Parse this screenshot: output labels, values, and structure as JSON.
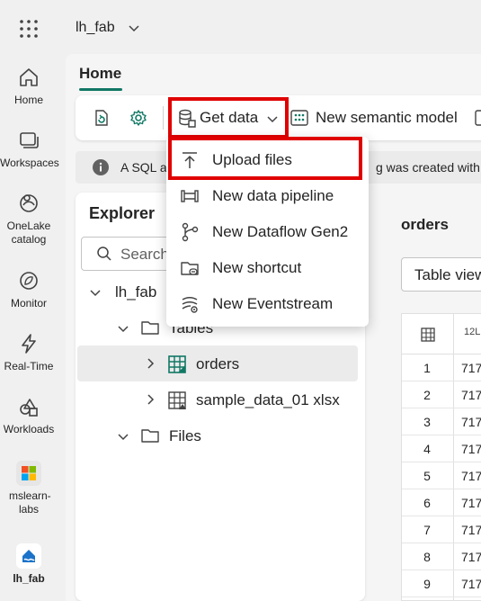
{
  "header": {
    "workspace_title": "lh_fab"
  },
  "rail": {
    "items": [
      {
        "label": "Home",
        "icon": "home-icon"
      },
      {
        "label": "Workspaces",
        "icon": "workspaces-icon"
      },
      {
        "label": "OneLake catalog",
        "icon": "onelake-icon"
      },
      {
        "label": "Monitor",
        "icon": "monitor-icon"
      },
      {
        "label": "Real-Time",
        "icon": "realtime-icon"
      },
      {
        "label": "Workloads",
        "icon": "workloads-icon"
      },
      {
        "label": "mslearn-labs",
        "icon": "workspace-logo-icon"
      },
      {
        "label": "lh_fab",
        "icon": "lakehouse-icon"
      }
    ]
  },
  "tabs": {
    "home": "Home"
  },
  "toolbar": {
    "get_data": "Get data",
    "new_semantic_model": "New semantic model"
  },
  "info": {
    "text_left": "A SQL a",
    "text_right": "g was created with t"
  },
  "explorer": {
    "title": "Explorer",
    "search_placeholder": "Search",
    "tree": {
      "root": "lh_fab",
      "tables": "Tables",
      "orders": "orders",
      "sample": "sample_data_01 xlsx",
      "files": "Files"
    }
  },
  "content": {
    "title": "orders",
    "view_button": "Table view",
    "column_header": "12L",
    "rows": [
      {
        "n": "1",
        "v": "717"
      },
      {
        "n": "2",
        "v": "717"
      },
      {
        "n": "3",
        "v": "717"
      },
      {
        "n": "4",
        "v": "717"
      },
      {
        "n": "5",
        "v": "717"
      },
      {
        "n": "6",
        "v": "717"
      },
      {
        "n": "7",
        "v": "717"
      },
      {
        "n": "8",
        "v": "717"
      },
      {
        "n": "9",
        "v": "717"
      }
    ]
  },
  "dropdown": {
    "items": [
      {
        "label": "Upload files",
        "icon": "upload-icon"
      },
      {
        "label": "New data pipeline",
        "icon": "pipeline-icon"
      },
      {
        "label": "New Dataflow Gen2",
        "icon": "dataflow-icon"
      },
      {
        "label": "New shortcut",
        "icon": "shortcut-icon"
      },
      {
        "label": "New Eventstream",
        "icon": "eventstream-icon"
      }
    ]
  },
  "colors": {
    "highlight_red": "#e00000",
    "accent_green": "#117865"
  }
}
